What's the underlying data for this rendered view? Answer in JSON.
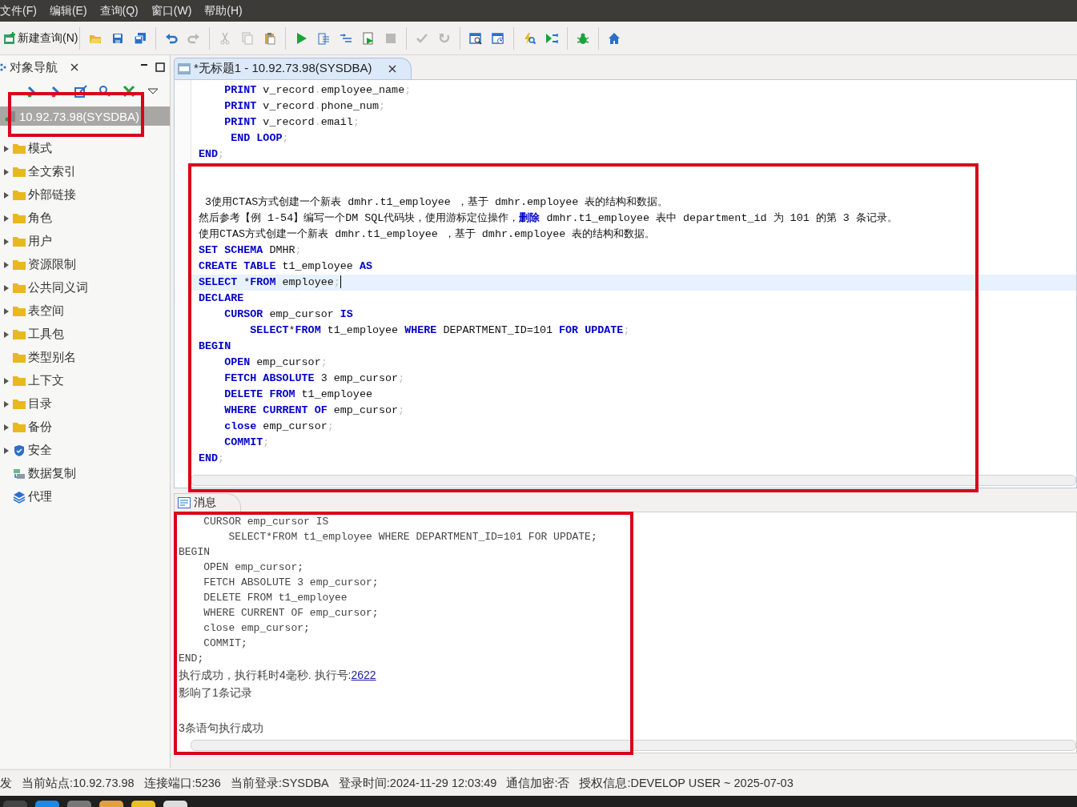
{
  "menu": [
    "文件(F)",
    "编辑(E)",
    "查询(Q)",
    "窗口(W)",
    "帮助(H)"
  ],
  "toolbar": {
    "new_query": "新建查询(N)",
    "groups": [
      [
        {
          "kind": "open",
          "disabled": false
        },
        {
          "kind": "save",
          "disabled": false
        },
        {
          "kind": "save-all",
          "disabled": false
        }
      ],
      [
        {
          "kind": "undo",
          "disabled": false
        },
        {
          "kind": "redo",
          "disabled": true
        }
      ],
      [
        {
          "kind": "cut",
          "disabled": true
        },
        {
          "kind": "copy",
          "disabled": true
        },
        {
          "kind": "paste",
          "disabled": false
        }
      ],
      [
        {
          "kind": "run",
          "disabled": false
        },
        {
          "kind": "step-into",
          "disabled": false
        },
        {
          "kind": "step-over",
          "disabled": false
        },
        {
          "kind": "run-script",
          "disabled": false
        },
        {
          "kind": "stop",
          "disabled": true
        }
      ],
      [
        {
          "kind": "commit",
          "disabled": true
        },
        {
          "kind": "rollback",
          "disabled": true
        }
      ],
      [
        {
          "kind": "calendar-search",
          "disabled": false
        },
        {
          "kind": "calendar-clock",
          "disabled": false
        }
      ],
      [
        {
          "kind": "bolt-search",
          "disabled": false
        },
        {
          "kind": "flow",
          "disabled": false
        }
      ],
      [
        {
          "kind": "bug",
          "disabled": false
        }
      ],
      [
        {
          "kind": "home",
          "disabled": false
        }
      ]
    ]
  },
  "navigator": {
    "title": "对象导航",
    "connection": {
      "label": "10.92.73.98(SYSDBA)",
      "selected": true
    },
    "items": [
      {
        "label": "模式",
        "expandable": true,
        "kind": "folder"
      },
      {
        "label": "全文索引",
        "expandable": true,
        "kind": "folder"
      },
      {
        "label": "外部链接",
        "expandable": true,
        "kind": "folder"
      },
      {
        "label": "角色",
        "expandable": true,
        "kind": "folder"
      },
      {
        "label": "用户",
        "expandable": true,
        "kind": "folder"
      },
      {
        "label": "资源限制",
        "expandable": true,
        "kind": "folder"
      },
      {
        "label": "公共同义词",
        "expandable": true,
        "kind": "folder"
      },
      {
        "label": "表空间",
        "expandable": true,
        "kind": "folder"
      },
      {
        "label": "工具包",
        "expandable": true,
        "kind": "folder"
      },
      {
        "label": "类型别名",
        "expandable": false,
        "kind": "folder"
      },
      {
        "label": "上下文",
        "expandable": true,
        "kind": "folder"
      },
      {
        "label": "目录",
        "expandable": true,
        "kind": "folder"
      },
      {
        "label": "备份",
        "expandable": true,
        "kind": "folder"
      },
      {
        "label": "安全",
        "expandable": true,
        "kind": "shield"
      },
      {
        "label": "数据复制",
        "expandable": false,
        "kind": "replication"
      },
      {
        "label": "代理",
        "expandable": false,
        "kind": "layers"
      }
    ]
  },
  "editor": {
    "tab": "*无标题1 - 10.92.73.98(SYSDBA)",
    "lines": [
      {
        "kind": "code",
        "current": false,
        "segments": [
          {
            "kind": "keyword",
            "text": "    PRINT"
          },
          {
            "kind": "plain",
            "text": " v_record"
          },
          {
            "kind": "punct",
            "text": "."
          },
          {
            "kind": "plain",
            "text": "employee_name"
          },
          {
            "kind": "punct",
            "text": ";"
          }
        ]
      },
      {
        "kind": "code",
        "current": false,
        "segments": [
          {
            "kind": "keyword",
            "text": "    PRINT"
          },
          {
            "kind": "plain",
            "text": " v_record"
          },
          {
            "kind": "punct",
            "text": "."
          },
          {
            "kind": "plain",
            "text": "phone_num"
          },
          {
            "kind": "punct",
            "text": ";"
          }
        ]
      },
      {
        "kind": "code",
        "current": false,
        "segments": [
          {
            "kind": "keyword",
            "text": "    PRINT"
          },
          {
            "kind": "plain",
            "text": " v_record"
          },
          {
            "kind": "punct",
            "text": "."
          },
          {
            "kind": "plain",
            "text": "email"
          },
          {
            "kind": "punct",
            "text": ";"
          }
        ]
      },
      {
        "kind": "code",
        "current": false,
        "segments": [
          {
            "kind": "keyword",
            "text": "     END LOOP"
          },
          {
            "kind": "punct",
            "text": ";"
          }
        ]
      },
      {
        "kind": "code",
        "current": false,
        "segments": [
          {
            "kind": "keyword",
            "text": "END"
          },
          {
            "kind": "punct",
            "text": ";"
          }
        ]
      },
      {
        "kind": "blank",
        "current": false
      },
      {
        "kind": "blank",
        "current": false
      },
      {
        "kind": "code",
        "current": false,
        "segments": [
          {
            "kind": "plain",
            "text": " 3使用CTAS方式创建一个新表 dmhr.t1_employee ，基于 dmhr.employee 表的结构和数据。"
          }
        ]
      },
      {
        "kind": "code",
        "current": false,
        "segments": [
          {
            "kind": "plain",
            "text": "然后参考【例 1-54】编写一个DM SQL代码块，使用游标定位操作，"
          },
          {
            "kind": "keyword",
            "text": "删除"
          },
          {
            "kind": "plain",
            "text": " dmhr.t1_employee 表中 department_id 为 101 的第 3 条记录。"
          }
        ]
      },
      {
        "kind": "code",
        "current": false,
        "segments": [
          {
            "kind": "plain",
            "text": "使用CTAS方式创建一个新表 dmhr.t1_employee ，基于 dmhr.employee 表的结构和数据。"
          }
        ]
      },
      {
        "kind": "code",
        "current": false,
        "segments": [
          {
            "kind": "keyword",
            "text": "SET SCHEMA"
          },
          {
            "kind": "plain",
            "text": " DMHR"
          },
          {
            "kind": "punct",
            "text": ";"
          }
        ]
      },
      {
        "kind": "code",
        "current": false,
        "segments": [
          {
            "kind": "keyword",
            "text": "CREATE TABLE"
          },
          {
            "kind": "plain",
            "text": " t1_employee "
          },
          {
            "kind": "keyword",
            "text": "AS"
          }
        ]
      },
      {
        "kind": "code",
        "current": true,
        "segments": [
          {
            "kind": "keyword",
            "text": "SELECT"
          },
          {
            "kind": "plain",
            "text": " *"
          },
          {
            "kind": "keyword",
            "text": "FROM"
          },
          {
            "kind": "plain",
            "text": " employee"
          },
          {
            "kind": "punct",
            "text": ";"
          }
        ]
      },
      {
        "kind": "code",
        "current": false,
        "segments": [
          {
            "kind": "keyword",
            "text": "DECLARE"
          }
        ]
      },
      {
        "kind": "code",
        "current": false,
        "segments": [
          {
            "kind": "keyword",
            "text": "    CURSOR"
          },
          {
            "kind": "plain",
            "text": " emp_cursor "
          },
          {
            "kind": "keyword",
            "text": "IS"
          }
        ]
      },
      {
        "kind": "code",
        "current": false,
        "segments": [
          {
            "kind": "keyword",
            "text": "        SELECT"
          },
          {
            "kind": "plain",
            "text": "*"
          },
          {
            "kind": "keyword",
            "text": "FROM"
          },
          {
            "kind": "plain",
            "text": " t1_employee "
          },
          {
            "kind": "keyword",
            "text": "WHERE"
          },
          {
            "kind": "plain",
            "text": " DEPARTMENT_ID=101 "
          },
          {
            "kind": "keyword",
            "text": "FOR UPDATE"
          },
          {
            "kind": "punct",
            "text": ";"
          }
        ]
      },
      {
        "kind": "code",
        "current": false,
        "segments": [
          {
            "kind": "keyword",
            "text": "BEGIN"
          }
        ]
      },
      {
        "kind": "code",
        "current": false,
        "segments": [
          {
            "kind": "keyword",
            "text": "    OPEN"
          },
          {
            "kind": "plain",
            "text": " emp_cursor"
          },
          {
            "kind": "punct",
            "text": ";"
          }
        ]
      },
      {
        "kind": "code",
        "current": false,
        "segments": [
          {
            "kind": "keyword",
            "text": "    FETCH ABSOLUTE"
          },
          {
            "kind": "plain",
            "text": " 3 emp_cursor"
          },
          {
            "kind": "punct",
            "text": ";"
          }
        ]
      },
      {
        "kind": "code",
        "current": false,
        "segments": [
          {
            "kind": "keyword",
            "text": "    DELETE FROM"
          },
          {
            "kind": "plain",
            "text": " t1_employee"
          }
        ]
      },
      {
        "kind": "code",
        "current": false,
        "segments": [
          {
            "kind": "keyword",
            "text": "    WHERE CURRENT OF"
          },
          {
            "kind": "plain",
            "text": " emp_cursor"
          },
          {
            "kind": "punct",
            "text": ";"
          }
        ]
      },
      {
        "kind": "code",
        "current": false,
        "segments": [
          {
            "kind": "keyword",
            "text": "    close"
          },
          {
            "kind": "plain",
            "text": " emp_cursor"
          },
          {
            "kind": "punct",
            "text": ";"
          }
        ]
      },
      {
        "kind": "code",
        "current": false,
        "segments": [
          {
            "kind": "keyword",
            "text": "    COMMIT"
          },
          {
            "kind": "punct",
            "text": ";"
          }
        ]
      },
      {
        "kind": "code",
        "current": false,
        "segments": [
          {
            "kind": "keyword",
            "text": "END"
          },
          {
            "kind": "punct",
            "text": ";"
          }
        ]
      }
    ]
  },
  "messages": {
    "tab": "消息",
    "lines": [
      {
        "kind": "code",
        "text": "    CURSOR emp_cursor IS"
      },
      {
        "kind": "code",
        "text": "        SELECT*FROM t1_employee WHERE DEPARTMENT_ID=101 FOR UPDATE;"
      },
      {
        "kind": "code",
        "text": "BEGIN"
      },
      {
        "kind": "code",
        "text": "    OPEN emp_cursor;"
      },
      {
        "kind": "code",
        "text": "    FETCH ABSOLUTE 3 emp_cursor;"
      },
      {
        "kind": "code",
        "text": "    DELETE FROM t1_employee"
      },
      {
        "kind": "code",
        "text": "    WHERE CURRENT OF emp_cursor;"
      },
      {
        "kind": "code",
        "text": "    close emp_cursor;"
      },
      {
        "kind": "code",
        "text": "    COMMIT;"
      },
      {
        "kind": "code",
        "text": "END;"
      },
      {
        "kind": "text",
        "text": "执行成功，执行耗时4毫秒. 执行号:",
        "link": "2622"
      },
      {
        "kind": "text",
        "text": "影响了1条记录"
      },
      {
        "kind": "blank"
      },
      {
        "kind": "text",
        "text": "3条语句执行成功"
      }
    ]
  },
  "status_bar": [
    "发",
    "当前站点:10.92.73.98",
    "连接端口:5236",
    "当前登录:SYSDBA",
    "登录时间:2024-11-29 12:03:49",
    "通信加密:否",
    "授权信息:DEVELOP USER ~ 2025-07-03"
  ]
}
